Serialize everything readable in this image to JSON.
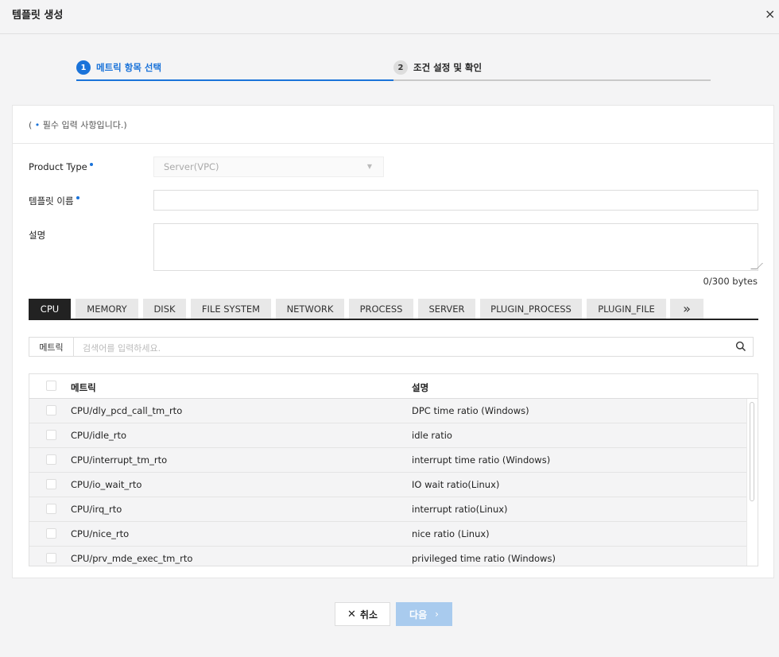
{
  "header": {
    "title": "템플릿 생성",
    "close_icon": "×"
  },
  "stepper": {
    "steps": [
      {
        "num": "1",
        "label": "메트릭 항목 선택"
      },
      {
        "num": "2",
        "label": "조건 설정 및 확인"
      }
    ]
  },
  "form": {
    "required_note_open": "( ",
    "required_note_dot": "•",
    "required_note_text": " 필수 입력 사항입니다.)",
    "product_type_label": "Product Type",
    "product_type_value": "Server(VPC)",
    "template_name_label": "템플릿 이름",
    "template_name_value": "",
    "description_label": "설명",
    "description_value": "",
    "byte_count": "0/300 bytes"
  },
  "tabs": [
    "CPU",
    "MEMORY",
    "DISK",
    "FILE SYSTEM",
    "NETWORK",
    "PROCESS",
    "SERVER",
    "PLUGIN_PROCESS",
    "PLUGIN_FILE",
    "»"
  ],
  "search": {
    "label": "메트릭",
    "placeholder": "검색어를 입력하세요."
  },
  "table": {
    "columns": [
      "메트릭",
      "설명"
    ],
    "rows": [
      {
        "metric": "CPU/dly_pcd_call_tm_rto",
        "desc": "DPC time ratio (Windows)"
      },
      {
        "metric": "CPU/idle_rto",
        "desc": "idle ratio"
      },
      {
        "metric": "CPU/interrupt_tm_rto",
        "desc": "interrupt time ratio (Windows)"
      },
      {
        "metric": "CPU/io_wait_rto",
        "desc": "IO wait ratio(Linux)"
      },
      {
        "metric": "CPU/irq_rto",
        "desc": "interrupt ratio(Linux)"
      },
      {
        "metric": "CPU/nice_rto",
        "desc": "nice ratio (Linux)"
      },
      {
        "metric": "CPU/prv_mde_exec_tm_rto",
        "desc": "privileged time ratio (Windows)"
      }
    ]
  },
  "buttons": {
    "cancel_icon": "✕",
    "cancel": "취소",
    "next": "다음",
    "next_icon": "›"
  },
  "colors": {
    "accent": "#1a73d9",
    "next_disabled": "#a9cbee",
    "tab_active": "#222222"
  }
}
